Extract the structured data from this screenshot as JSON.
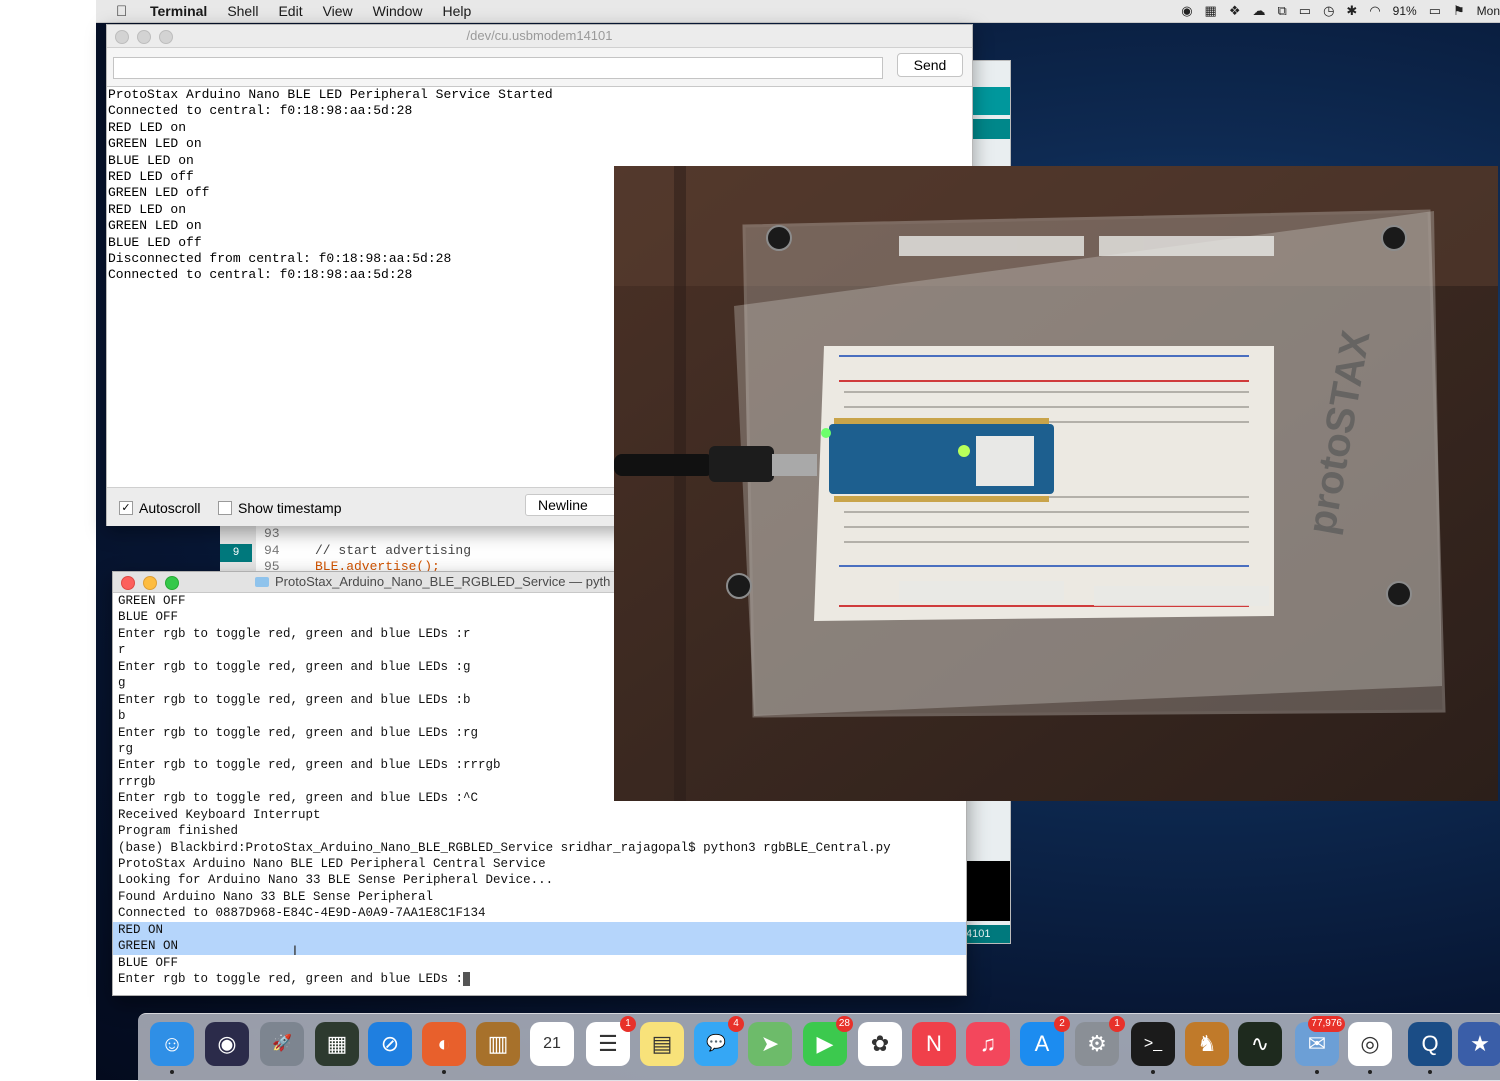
{
  "menubar": {
    "apple": "",
    "app": "Terminal",
    "items": [
      "Shell",
      "Edit",
      "View",
      "Window",
      "Help"
    ],
    "battery": "91%",
    "clock": "Mon"
  },
  "serial_monitor": {
    "title": "/dev/cu.usbmodem14101",
    "send_label": "Send",
    "input_value": "",
    "lines": [
      "ProtoStax Arduino Nano BLE LED Peripheral Service Started",
      "Connected to central: f0:18:98:aa:5d:28",
      "RED LED on",
      "GREEN LED on",
      "BLUE LED on",
      "RED LED off",
      "GREEN LED off",
      "RED LED on",
      "GREEN LED on",
      "BLUE LED off",
      "Disconnected from central: f0:18:98:aa:5d:28",
      "Connected to central: f0:18:98:aa:5d:28"
    ],
    "autoscroll_label": "Autoscroll",
    "autoscroll_checked": true,
    "timestamp_label": "Show timestamp",
    "timestamp_checked": false,
    "line_ending": "Newline"
  },
  "ide_code": {
    "badge": "9",
    "lines": [
      {
        "num": "93",
        "code": ""
      },
      {
        "num": "94",
        "code": "// start advertising"
      },
      {
        "num": "95",
        "code": "BLE.advertise();"
      }
    ],
    "status_text": "4101"
  },
  "terminal": {
    "title": "ProtoStax_Arduino_Nano_BLE_RGBLED_Service — pyth",
    "lines": [
      "GREEN OFF",
      "BLUE OFF",
      "Enter rgb to toggle red, green and blue LEDs :r",
      "r",
      "Enter rgb to toggle red, green and blue LEDs :g",
      "g",
      "Enter rgb to toggle red, green and blue LEDs :b",
      "b",
      "Enter rgb to toggle red, green and blue LEDs :rg",
      "rg",
      "Enter rgb to toggle red, green and blue LEDs :rrrgb",
      "rrrgb",
      "Enter rgb to toggle red, green and blue LEDs :^C",
      "Received Keyboard Interrupt",
      "Program finished",
      "(base) Blackbird:ProtoStax_Arduino_Nano_BLE_RGBLED_Service sridhar_rajagopal$ python3 rgbBLE_Central.py",
      "ProtoStax Arduino Nano BLE LED Peripheral Central Service",
      "Looking for Arduino Nano 33 BLE Sense Peripheral Device...",
      "Found Arduino Nano 33 BLE Sense Peripheral",
      "Connected to 0887D968-E84C-4E9D-A0A9-7AA1E8C1F134",
      "RED ON",
      "GREEN ON",
      "BLUE OFF",
      "Enter rgb to toggle red, green and blue LEDs :"
    ],
    "selected_lines": [
      20,
      21
    ]
  },
  "photo": {
    "brand": "protoSTAX"
  },
  "dock": {
    "items": [
      {
        "name": "finder",
        "badge": "",
        "color": "#2f8fe6",
        "glyph": "☺",
        "running": true
      },
      {
        "name": "siri",
        "badge": "",
        "color": "#2b2b4a",
        "glyph": "◉",
        "running": false
      },
      {
        "name": "launchpad",
        "badge": "",
        "color": "#7d8590",
        "glyph": "🚀",
        "running": false
      },
      {
        "name": "mission-control",
        "badge": "",
        "color": "#2d3a2f",
        "glyph": "▦",
        "running": false
      },
      {
        "name": "safari",
        "badge": "",
        "color": "#1f7fe0",
        "glyph": "⊘",
        "running": false
      },
      {
        "name": "firefox",
        "badge": "",
        "color": "#e8602c",
        "glyph": "◐",
        "running": true
      },
      {
        "name": "notebook",
        "badge": "",
        "color": "#a7712b",
        "glyph": "▥",
        "running": false
      },
      {
        "name": "calendar",
        "badge": "",
        "color": "#ffffff",
        "glyph": "21",
        "running": false
      },
      {
        "name": "reminders",
        "badge": "1",
        "color": "#ffffff",
        "glyph": "☰",
        "running": false
      },
      {
        "name": "notes",
        "badge": "",
        "color": "#f8e27a",
        "glyph": "▤",
        "running": false
      },
      {
        "name": "messages",
        "badge": "4",
        "color": "#35a7f5",
        "glyph": "💬",
        "running": false
      },
      {
        "name": "maps",
        "badge": "",
        "color": "#6dbb6a",
        "glyph": "➤",
        "running": false
      },
      {
        "name": "facetime",
        "badge": "28",
        "color": "#3cc94e",
        "glyph": "▶",
        "running": false
      },
      {
        "name": "photos",
        "badge": "",
        "color": "#ffffff",
        "glyph": "✿",
        "running": false
      },
      {
        "name": "news",
        "badge": "",
        "color": "#f0404a",
        "glyph": "N",
        "running": false
      },
      {
        "name": "music",
        "badge": "",
        "color": "#f3475c",
        "glyph": "♫",
        "running": false
      },
      {
        "name": "app-store",
        "badge": "2",
        "color": "#1c8cf0",
        "glyph": "A",
        "running": false
      },
      {
        "name": "system-preferences",
        "badge": "1",
        "color": "#8a8f96",
        "glyph": "⚙",
        "running": false
      },
      {
        "name": "terminal",
        "badge": "",
        "color": "#1b1b1b",
        "glyph": ">_",
        "running": true
      },
      {
        "name": "gnu-app",
        "badge": "",
        "color": "#c07a2a",
        "glyph": "♞",
        "running": false
      },
      {
        "name": "activity-monitor",
        "badge": "",
        "color": "#1e2a1e",
        "glyph": "∿",
        "running": false
      },
      {
        "name": "mail",
        "badge": "77,976",
        "color": "#6c9fd6",
        "glyph": "✉",
        "running": true
      },
      {
        "name": "chrome",
        "badge": "",
        "color": "#ffffff",
        "glyph": "◎",
        "running": true
      },
      {
        "name": "quicktime",
        "badge": "",
        "color": "#1b4d86",
        "glyph": "Q",
        "running": true
      },
      {
        "name": "bookmark",
        "badge": "",
        "color": "#3a5ea8",
        "glyph": "★",
        "running": false
      }
    ]
  }
}
